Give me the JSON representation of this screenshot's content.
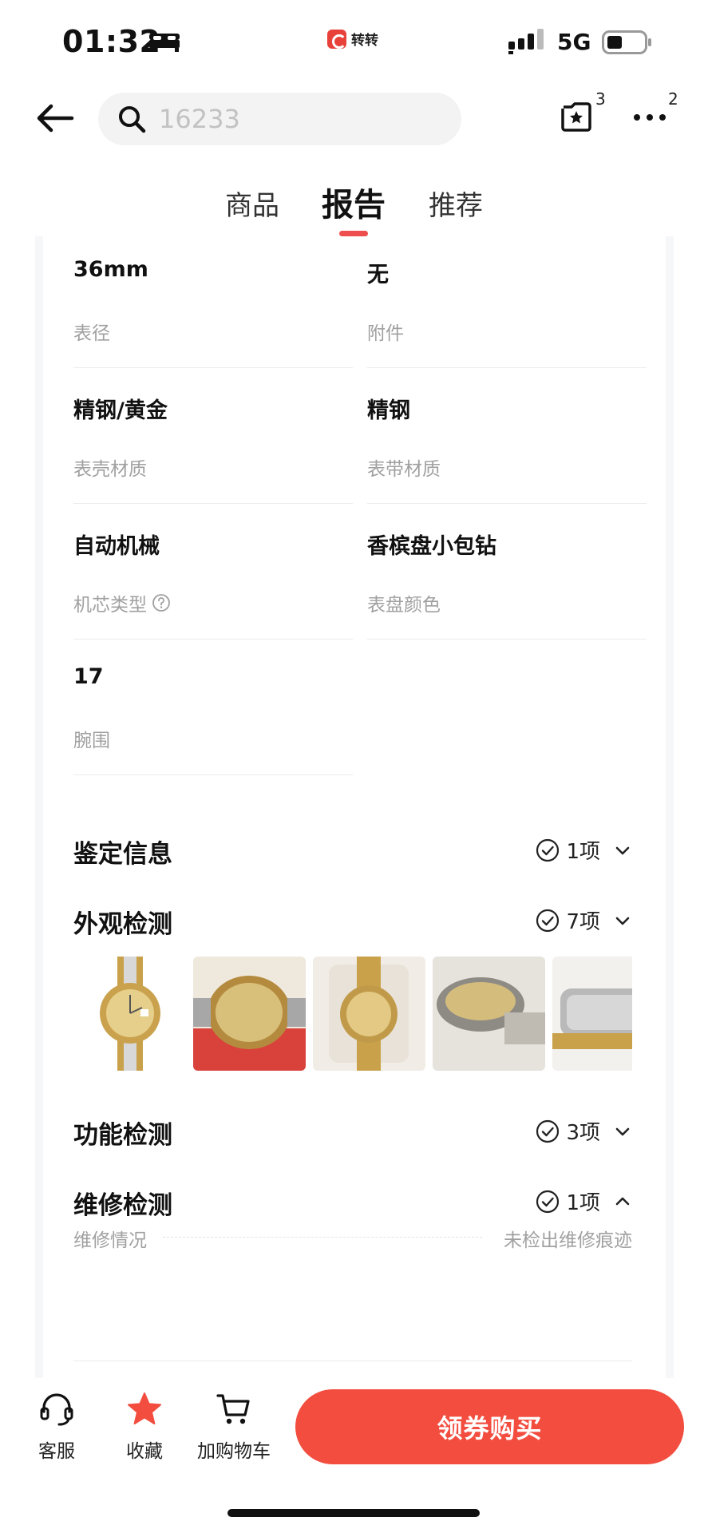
{
  "status_bar": {
    "time": "01:32",
    "brand": "转转",
    "network": "5G"
  },
  "header": {
    "search_placeholder": "16233",
    "favorite_badge": "3",
    "more_badge": "2"
  },
  "tabs": [
    {
      "label": "商品",
      "active": false
    },
    {
      "label": "报告",
      "active": true
    },
    {
      "label": "推荐",
      "active": false
    }
  ],
  "specs": [
    {
      "value": "36mm",
      "label": "表径"
    },
    {
      "value": "无",
      "label": "附件"
    },
    {
      "value": "精钢/黄金",
      "label": "表壳材质"
    },
    {
      "value": "精钢",
      "label": "表带材质"
    },
    {
      "value": "自动机械",
      "label": "机芯类型"
    },
    {
      "value": "香槟盘小包钻",
      "label": "表盘颜色"
    },
    {
      "value": "17",
      "label": "腕围"
    }
  ],
  "sections": {
    "authentication": {
      "title": "鉴定信息",
      "count": "1项",
      "expanded": false
    },
    "appearance": {
      "title": "外观检测",
      "count": "7项",
      "expanded": true
    },
    "function": {
      "title": "功能检测",
      "count": "3项",
      "expanded": false
    },
    "repair": {
      "title": "维修检测",
      "count": "1项",
      "expanded": true
    }
  },
  "repair_detail": {
    "label": "维修情况",
    "value": "未检出维修痕迹"
  },
  "bottom_bar": {
    "service_label": "客服",
    "collect_label": "收藏",
    "cart_label": "加购物车",
    "buy_label": "领券购买"
  },
  "colors": {
    "accent": "#f34d3f",
    "tab_indicator": "#ee4e4e",
    "muted_text": "#a0a0a0"
  }
}
